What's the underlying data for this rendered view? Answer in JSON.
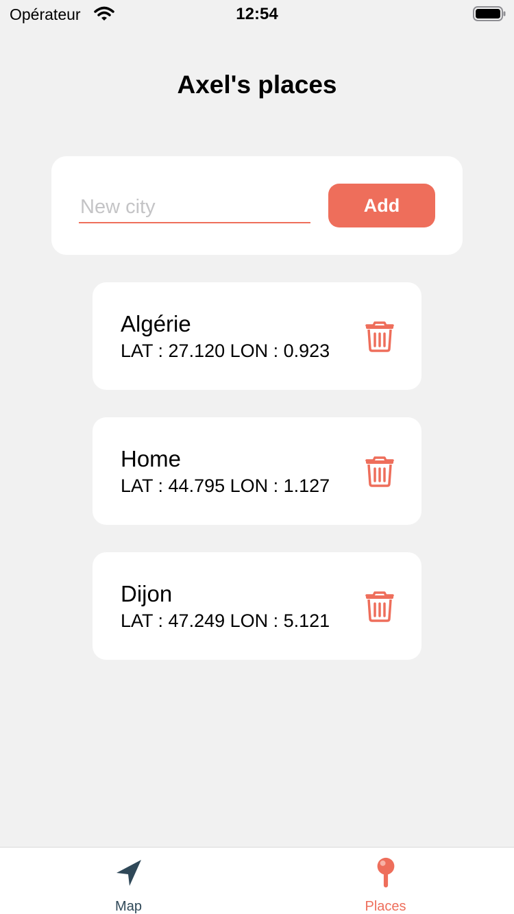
{
  "status_bar": {
    "carrier": "Opérateur",
    "time": "12:54",
    "wifi_icon": "wifi-icon",
    "battery_icon": "battery-icon"
  },
  "header": {
    "title": "Axel's places"
  },
  "add_form": {
    "placeholder": "New city",
    "value": "",
    "button_label": "Add"
  },
  "places": [
    {
      "name": "Algérie",
      "coords": "LAT : 27.120 LON : 0.923"
    },
    {
      "name": "Home",
      "coords": "LAT : 44.795 LON : 1.127"
    },
    {
      "name": "Dijon",
      "coords": "LAT : 47.249 LON : 5.121"
    }
  ],
  "tabs": [
    {
      "label": "Map",
      "icon": "navigation-arrow-icon",
      "selected": false
    },
    {
      "label": "Places",
      "icon": "map-pin-icon",
      "selected": true
    }
  ],
  "colors": {
    "accent": "#ee6e5b",
    "tab_inactive": "#2f4858",
    "background": "#f1f1f1"
  }
}
